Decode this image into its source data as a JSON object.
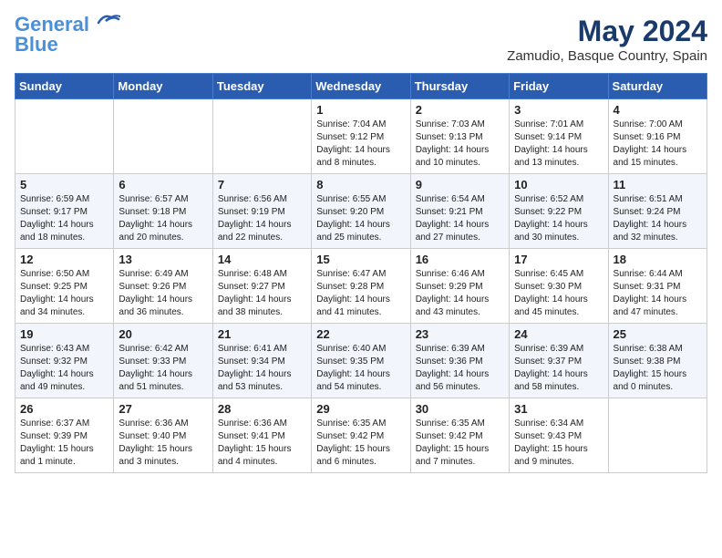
{
  "header": {
    "logo_line1": "General",
    "logo_line2": "Blue",
    "month_year": "May 2024",
    "location": "Zamudio, Basque Country, Spain"
  },
  "days_of_week": [
    "Sunday",
    "Monday",
    "Tuesday",
    "Wednesday",
    "Thursday",
    "Friday",
    "Saturday"
  ],
  "weeks": [
    [
      {
        "day": "",
        "info": ""
      },
      {
        "day": "",
        "info": ""
      },
      {
        "day": "",
        "info": ""
      },
      {
        "day": "1",
        "info": "Sunrise: 7:04 AM\nSunset: 9:12 PM\nDaylight: 14 hours\nand 8 minutes."
      },
      {
        "day": "2",
        "info": "Sunrise: 7:03 AM\nSunset: 9:13 PM\nDaylight: 14 hours\nand 10 minutes."
      },
      {
        "day": "3",
        "info": "Sunrise: 7:01 AM\nSunset: 9:14 PM\nDaylight: 14 hours\nand 13 minutes."
      },
      {
        "day": "4",
        "info": "Sunrise: 7:00 AM\nSunset: 9:16 PM\nDaylight: 14 hours\nand 15 minutes."
      }
    ],
    [
      {
        "day": "5",
        "info": "Sunrise: 6:59 AM\nSunset: 9:17 PM\nDaylight: 14 hours\nand 18 minutes."
      },
      {
        "day": "6",
        "info": "Sunrise: 6:57 AM\nSunset: 9:18 PM\nDaylight: 14 hours\nand 20 minutes."
      },
      {
        "day": "7",
        "info": "Sunrise: 6:56 AM\nSunset: 9:19 PM\nDaylight: 14 hours\nand 22 minutes."
      },
      {
        "day": "8",
        "info": "Sunrise: 6:55 AM\nSunset: 9:20 PM\nDaylight: 14 hours\nand 25 minutes."
      },
      {
        "day": "9",
        "info": "Sunrise: 6:54 AM\nSunset: 9:21 PM\nDaylight: 14 hours\nand 27 minutes."
      },
      {
        "day": "10",
        "info": "Sunrise: 6:52 AM\nSunset: 9:22 PM\nDaylight: 14 hours\nand 30 minutes."
      },
      {
        "day": "11",
        "info": "Sunrise: 6:51 AM\nSunset: 9:24 PM\nDaylight: 14 hours\nand 32 minutes."
      }
    ],
    [
      {
        "day": "12",
        "info": "Sunrise: 6:50 AM\nSunset: 9:25 PM\nDaylight: 14 hours\nand 34 minutes."
      },
      {
        "day": "13",
        "info": "Sunrise: 6:49 AM\nSunset: 9:26 PM\nDaylight: 14 hours\nand 36 minutes."
      },
      {
        "day": "14",
        "info": "Sunrise: 6:48 AM\nSunset: 9:27 PM\nDaylight: 14 hours\nand 38 minutes."
      },
      {
        "day": "15",
        "info": "Sunrise: 6:47 AM\nSunset: 9:28 PM\nDaylight: 14 hours\nand 41 minutes."
      },
      {
        "day": "16",
        "info": "Sunrise: 6:46 AM\nSunset: 9:29 PM\nDaylight: 14 hours\nand 43 minutes."
      },
      {
        "day": "17",
        "info": "Sunrise: 6:45 AM\nSunset: 9:30 PM\nDaylight: 14 hours\nand 45 minutes."
      },
      {
        "day": "18",
        "info": "Sunrise: 6:44 AM\nSunset: 9:31 PM\nDaylight: 14 hours\nand 47 minutes."
      }
    ],
    [
      {
        "day": "19",
        "info": "Sunrise: 6:43 AM\nSunset: 9:32 PM\nDaylight: 14 hours\nand 49 minutes."
      },
      {
        "day": "20",
        "info": "Sunrise: 6:42 AM\nSunset: 9:33 PM\nDaylight: 14 hours\nand 51 minutes."
      },
      {
        "day": "21",
        "info": "Sunrise: 6:41 AM\nSunset: 9:34 PM\nDaylight: 14 hours\nand 53 minutes."
      },
      {
        "day": "22",
        "info": "Sunrise: 6:40 AM\nSunset: 9:35 PM\nDaylight: 14 hours\nand 54 minutes."
      },
      {
        "day": "23",
        "info": "Sunrise: 6:39 AM\nSunset: 9:36 PM\nDaylight: 14 hours\nand 56 minutes."
      },
      {
        "day": "24",
        "info": "Sunrise: 6:39 AM\nSunset: 9:37 PM\nDaylight: 14 hours\nand 58 minutes."
      },
      {
        "day": "25",
        "info": "Sunrise: 6:38 AM\nSunset: 9:38 PM\nDaylight: 15 hours\nand 0 minutes."
      }
    ],
    [
      {
        "day": "26",
        "info": "Sunrise: 6:37 AM\nSunset: 9:39 PM\nDaylight: 15 hours\nand 1 minute."
      },
      {
        "day": "27",
        "info": "Sunrise: 6:36 AM\nSunset: 9:40 PM\nDaylight: 15 hours\nand 3 minutes."
      },
      {
        "day": "28",
        "info": "Sunrise: 6:36 AM\nSunset: 9:41 PM\nDaylight: 15 hours\nand 4 minutes."
      },
      {
        "day": "29",
        "info": "Sunrise: 6:35 AM\nSunset: 9:42 PM\nDaylight: 15 hours\nand 6 minutes."
      },
      {
        "day": "30",
        "info": "Sunrise: 6:35 AM\nSunset: 9:42 PM\nDaylight: 15 hours\nand 7 minutes."
      },
      {
        "day": "31",
        "info": "Sunrise: 6:34 AM\nSunset: 9:43 PM\nDaylight: 15 hours\nand 9 minutes."
      },
      {
        "day": "",
        "info": ""
      }
    ]
  ]
}
